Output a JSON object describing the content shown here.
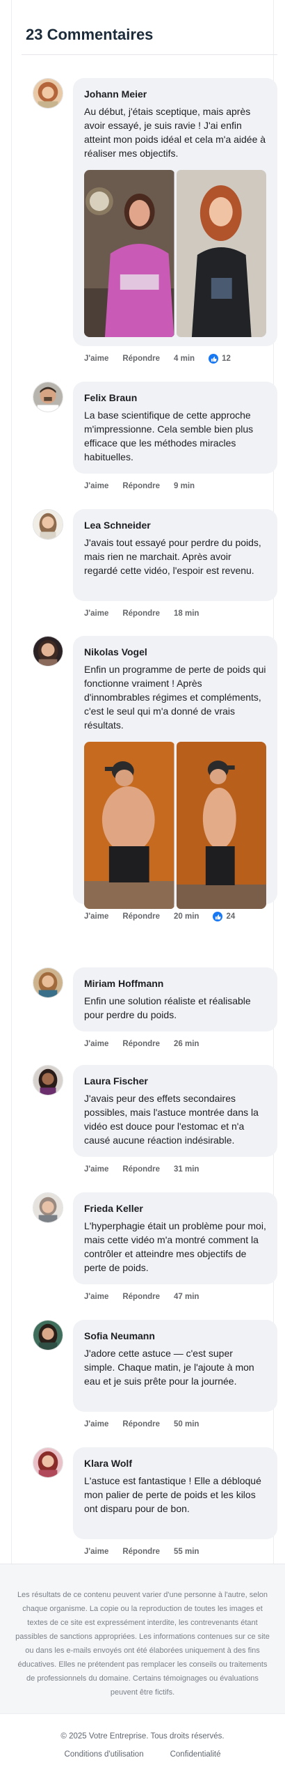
{
  "header": {
    "title": "23 Commentaires"
  },
  "comments": [
    {
      "author": "Johann Meier",
      "text": "Au début, j'étais sceptique, mais après avoir essayé, je suis ravie ! J'ai enfin atteint mon poids idéal et cela m'a aidée à réaliser mes objectifs.",
      "like": "J'aime",
      "reply": "Répondre",
      "time": "4 min",
      "likes": "12"
    },
    {
      "author": "Felix Braun",
      "text": "La base scientifique de cette approche m'impressionne. Cela semble bien plus efficace que les méthodes miracles habituelles.",
      "like": "J'aime",
      "reply": "Répondre",
      "time": "9 min"
    },
    {
      "author": "Lea Schneider",
      "text": "J'avais tout essayé pour perdre du poids, mais rien ne marchait. Après avoir regardé cette vidéo, l'espoir est revenu.",
      "like": "J'aime",
      "reply": "Répondre",
      "time": "18 min"
    },
    {
      "author": "Nikolas Vogel",
      "text": "Enfin un programme de perte de poids qui fonctionne vraiment ! Après d'innombrables régimes et compléments, c'est le seul qui m'a donné de vrais résultats.",
      "like": "J'aime",
      "reply": "Répondre",
      "time": "20 min",
      "likes": "24"
    },
    {
      "author": "Miriam Hoffmann",
      "text": "Enfin une solution réaliste et réalisable pour perdre du poids.",
      "like": "J'aime",
      "reply": "Répondre",
      "time": "26 min"
    },
    {
      "author": "Laura Fischer",
      "text": "J'avais peur des effets secondaires possibles, mais l'astuce montrée dans la vidéo est douce pour l'estomac et n'a causé aucune réaction indésirable.",
      "like": "J'aime",
      "reply": "Répondre",
      "time": "31 min"
    },
    {
      "author": "Frieda Keller",
      "text": "L'hyperphagie était un problème pour moi, mais cette vidéo m'a montré comment la contrôler et atteindre mes objectifs de perte de poids.",
      "like": "J'aime",
      "reply": "Répondre",
      "time": "47 min"
    },
    {
      "author": "Sofia Neumann",
      "text": "J'adore cette astuce — c'est super simple. Chaque matin, je l'ajoute à mon eau et je suis prête pour la journée.",
      "like": "J'aime",
      "reply": "Répondre",
      "time": "50 min"
    },
    {
      "author": "Klara Wolf",
      "text": "L'astuce est fantastique ! Elle a débloqué mon palier de perte de poids et les kilos ont disparu pour de bon.",
      "like": "J'aime",
      "reply": "Répondre",
      "time": "55 min"
    }
  ],
  "icons": {
    "like": "thumbs-up-icon"
  },
  "colors": {
    "bubble": "#f0f2f5",
    "like_blue": "#1877f2",
    "muted": "#65676b"
  },
  "disclaimer": "Les résultats de ce contenu peuvent varier d'une personne à l'autre, selon chaque organisme. La copie ou la reproduction de toutes les images et textes de ce site est expressément interdite, les contrevenants étant passibles de sanctions appropriées. Les informations contenues sur ce site ou dans les e-mails envoyés ont été élaborées uniquement à des fins éducatives. Elles ne prétendent pas remplacer les conseils ou traitements de professionnels du domaine. Certains témoignages ou évaluations peuvent être fictifs.",
  "footer": {
    "copyright": "© 2025 Votre Entreprise. Tous droits réservés.",
    "terms": "Conditions d'utilisation",
    "privacy": "Confidentialité"
  }
}
